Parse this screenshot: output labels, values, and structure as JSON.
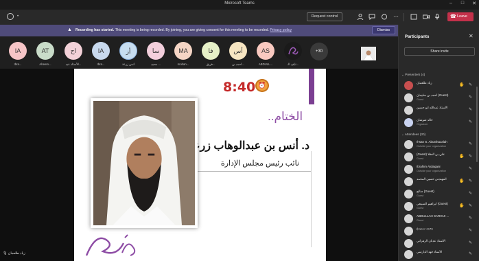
{
  "window": {
    "title": "Microsoft Teams",
    "controls": [
      "–",
      "□",
      "✕"
    ]
  },
  "toolbar": {
    "request_control": "Request control",
    "leave": "Leave",
    "icons": [
      "timer-icon",
      "people-icon",
      "chat-icon",
      "reactions-icon",
      "more-icon",
      "view-icon",
      "camera-icon",
      "mic-icon",
      "share-icon"
    ]
  },
  "banner": {
    "title": "Recording has started.",
    "body": " This meeting is being recorded. By joining, you are giving consent for this meeting to be recorded. ",
    "link": "Privacy policy",
    "dismiss": "Dismiss"
  },
  "strip": {
    "attendees": [
      {
        "initials": "IA",
        "name": "Ibra...",
        "color": "#f6c5c7"
      },
      {
        "initials": "AT",
        "name": "Alreem...",
        "color": "#c9dcc9"
      },
      {
        "initials": "اح",
        "name": "الأستاذ عبد...",
        "color": "#f3d1d8"
      },
      {
        "initials": "IA",
        "name": "Ibra...",
        "color": "#c8d9ee"
      },
      {
        "initials": "أز",
        "name": "أنس زرعة",
        "color": "#c7ddf0"
      },
      {
        "initials": "سا",
        "name": "سعيد ...",
        "color": "#f3cfdc"
      },
      {
        "initials": "MA",
        "name": "mohan...",
        "color": "#f5d5c5"
      },
      {
        "initials": "فا",
        "name": "فريق...",
        "color": "#e6f0c7"
      },
      {
        "initials": "أس",
        "name": "أحمد بن...",
        "color": "#f7e6c2"
      },
      {
        "initials": "AS",
        "name": "ABDULL...",
        "color": "#f9c9c0"
      },
      {
        "initials": "",
        "name": "نايف الـ...",
        "color": "#1a1a1a"
      }
    ],
    "more": "+30"
  },
  "slide": {
    "clock": "8:40",
    "heading": "الختام..",
    "speaker": "د. أنس بن عبدالوهاب زرعة",
    "role": "نائب رئيس مجلس الإدارة"
  },
  "self_label": "زياد طلعمان",
  "participants": {
    "title": "Participants",
    "share_invite": "Share invite",
    "presenters_label": "Presenters (4)",
    "presenters": [
      {
        "name": "زياد طلعمان",
        "sub": "",
        "color": "#c84f4f",
        "hand": true
      },
      {
        "name": "أحمد بن سليمان (Guest)",
        "sub": "Guest",
        "color": "#d6d6d6",
        "hand": false
      },
      {
        "name": "الأستاذ عبدالله أبو حسين",
        "sub": "",
        "color": "#d6d6d6",
        "hand": false
      },
      {
        "name": "خالد شوشان",
        "sub": "Organizer",
        "color": "#c9d3f0",
        "hand": false
      }
    ],
    "attendees_label": "Attendees (30)",
    "attendees": [
      {
        "name": "Ihsan S. AbuGhazalah",
        "sub": "Outside your organization",
        "color": "#d6d6d6",
        "hand": false
      },
      {
        "name": "(Guest) علي بن العقلا",
        "sub": "Guest",
        "color": "#d6d6d6",
        "hand": true
      },
      {
        "name": "Ibrahim Alolaqani",
        "sub": "Outside your organization",
        "color": "#d6d6d6",
        "hand": false
      },
      {
        "name": "المهندس حسين المحمد",
        "sub": "",
        "color": "#d6d6d6",
        "hand": true
      },
      {
        "name": "صالح (Guest)",
        "sub": "Guest",
        "color": "#d6d6d6",
        "hand": false
      },
      {
        "name": "ابراهيم السبيعي (Guest)",
        "sub": "Guest",
        "color": "#d6d6d6",
        "hand": true
      },
      {
        "name": "ABDULLAH SAROUI ...",
        "sub": "Guest",
        "color": "#d6d6d6",
        "hand": false
      },
      {
        "name": "محمد سميدع",
        "sub": "",
        "color": "#d6d6d6",
        "hand": false
      },
      {
        "name": "الأستاذ عدنان الزهراني",
        "sub": "",
        "color": "#d6d6d6",
        "hand": false
      },
      {
        "name": "الأستاذ فهد الدارسي",
        "sub": "",
        "color": "#d6d6d6",
        "hand": false
      }
    ]
  }
}
